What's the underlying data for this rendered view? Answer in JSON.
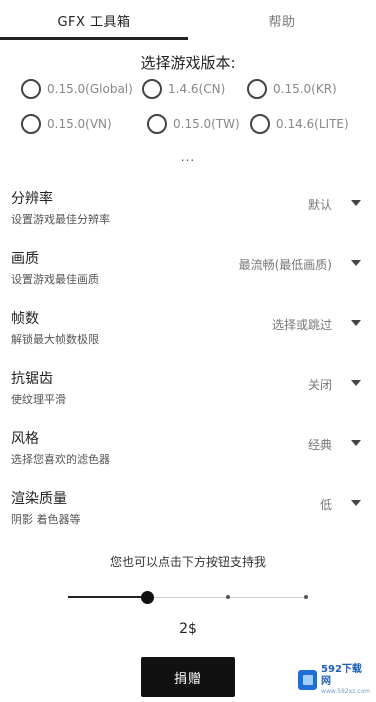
{
  "tabs": [
    {
      "label": "GFX 工具箱",
      "active": true
    },
    {
      "label": "帮助",
      "active": false
    }
  ],
  "version_title": "选择游戏版本:",
  "versions": [
    "0.15.0(Global)",
    "1.4.6(CN)",
    "0.15.0(KR)",
    "0.15.0(VN)",
    "0.15.0(TW)",
    "0.14.6(LITE)"
  ],
  "more": "...",
  "settings": [
    {
      "title": "分辨率",
      "desc": "设置游戏最佳分辨率",
      "value": "默认"
    },
    {
      "title": "画质",
      "desc": "设置游戏最佳画质",
      "value": "最流畅(最低画质)"
    },
    {
      "title": "帧数",
      "desc": "解锁最大帧数极限",
      "value": "选择或跳过"
    },
    {
      "title": "抗锯齿",
      "desc": "使纹理平滑",
      "value": "关闭"
    },
    {
      "title": "风格",
      "desc": "选择您喜欢的滤色器",
      "value": "经典"
    },
    {
      "title": "渲染质量",
      "desc": "阴影 着色器等",
      "value": "低"
    }
  ],
  "support": {
    "text": "您也可以点击下方按钮支持我",
    "slider_value_fraction": 0.33,
    "amount": "2$",
    "button_label": "捐赠"
  },
  "watermark": {
    "main": "592下载网",
    "sub": "www.592xz.com"
  },
  "colors": {
    "accent": "#111111",
    "tab_inactive": "#777777",
    "watermark": "#1e6fd6"
  }
}
